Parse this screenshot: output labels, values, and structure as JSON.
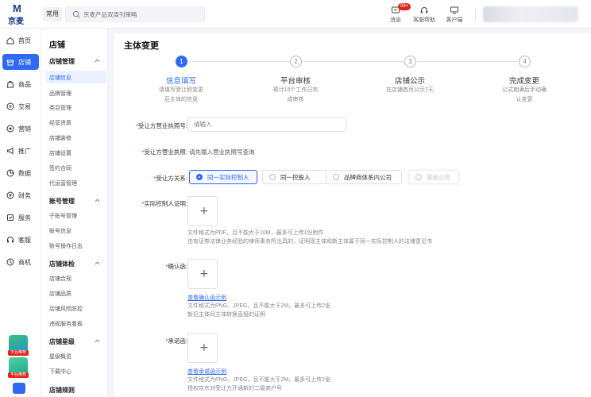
{
  "topbar": {
    "logo_letter": "M",
    "logo_text": "京麦",
    "common_label": "常用",
    "search_placeholder": "京麦产品双周刊策略",
    "tools": [
      {
        "label": "消息",
        "badge": "99+"
      },
      {
        "label": "客服帮助"
      },
      {
        "label": "客户端"
      }
    ]
  },
  "rail": {
    "items": [
      {
        "label": "首页",
        "icon": "home-icon"
      },
      {
        "label": "店铺",
        "icon": "store-icon",
        "active": true
      },
      {
        "label": "商品",
        "icon": "goods-icon"
      },
      {
        "label": "交易",
        "icon": "trade-icon"
      },
      {
        "label": "营销",
        "icon": "marketing-icon"
      },
      {
        "label": "推广",
        "icon": "promotion-icon"
      },
      {
        "label": "数据",
        "icon": "data-icon"
      },
      {
        "label": "财务",
        "icon": "finance-icon"
      },
      {
        "label": "服务",
        "icon": "service-icon"
      },
      {
        "label": "客服",
        "icon": "customer-service-icon"
      },
      {
        "label": "商机",
        "icon": "opportunity-icon"
      }
    ],
    "promo_tag_1": "平台推荐",
    "promo_tag_2": "平台推荐"
  },
  "submenu": {
    "title": "店铺",
    "groups": [
      {
        "label": "店铺管理",
        "items": [
          "店铺信息",
          "品牌管理",
          "类目管理",
          "经营资质",
          "店铺装修",
          "店铺设置",
          "签约合同",
          "代运营管理"
        ]
      },
      {
        "label": "账号管理",
        "items": [
          "子账号管理",
          "账号信息",
          "账号操作日志"
        ]
      },
      {
        "label": "店铺体检",
        "items": [
          "店铺合规",
          "店铺品质",
          "店铺风险防控",
          "违规服务看板"
        ]
      },
      {
        "label": "店铺星级",
        "items": [
          "星级概览",
          "下载中心"
        ]
      },
      {
        "label": "店铺规则",
        "items": []
      }
    ],
    "active_item": "店铺信息"
  },
  "main": {
    "title": "主体变更",
    "steps": [
      {
        "num": "1",
        "title": "信息填写",
        "desc": [
          "请填写受让即变更",
          "后主体的信息"
        ],
        "active": true
      },
      {
        "num": "2",
        "title": "平台审核",
        "desc": [
          "预计15个工作日完",
          "成审核"
        ]
      },
      {
        "num": "3",
        "title": "店铺公示",
        "desc": [
          "在店铺首页公示7天"
        ]
      },
      {
        "num": "4",
        "title": "完成变更",
        "desc": [
          "公式期满后手动确",
          "认变更"
        ]
      }
    ],
    "form": {
      "license_label": "受让方营业执照号:",
      "license_placeholder": "请输入",
      "license2_label": "受让方营业执照:",
      "license2_value": "请先输入营业执照号查询",
      "relation_label": "受让方关系:",
      "relation_options": [
        "同一实际控制人",
        "同一控股人",
        "品牌商体系内公司",
        "其他公司"
      ],
      "relation_selected": "同一实际控制人",
      "controller_label": "实际控制人证明:",
      "controller_hint": [
        "文件格式为PDF，且不能大于10M，最多可上传1份附件",
        "由有证券法律业务经验的律师事务所出具的、证明现主体和新主体属于同一实际控制人的法律意见书"
      ],
      "confirm_label": "确认函:",
      "confirm_link": "查看确认函示例",
      "confirm_hint": [
        "文件格式为PNG、JPEG，且不能大于2M，最多可上传2张",
        "新旧主体间主体转换直接的证明"
      ],
      "promise_label": "承诺函:",
      "promise_link": "查看承诺函示例",
      "promise_hint": [
        "文件格式为PNG、JPEG，且不能大于2M，最多可上传2张",
        "授权京东对受让方开通新的二级商户号"
      ],
      "upload_plus": "+"
    }
  },
  "colors": {
    "accent": "#2f6af5",
    "brand_red": "#e1251b"
  }
}
